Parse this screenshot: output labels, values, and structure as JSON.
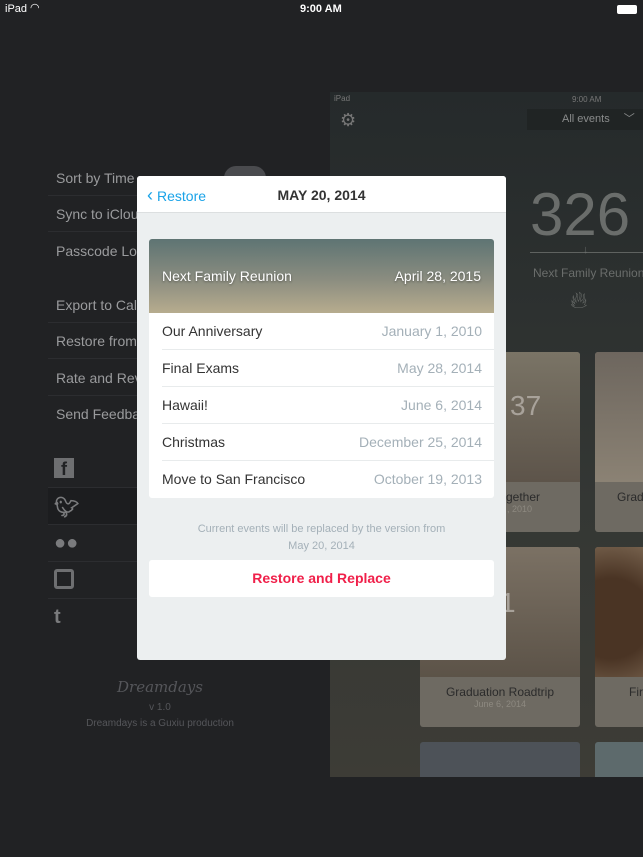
{
  "status_bar": {
    "device": "iPad",
    "time": "9:00 AM"
  },
  "settings_menu": {
    "items": [
      "Sort by Time",
      "Sync to iCloud",
      "Passcode Lock",
      "Export to Calendar",
      "Restore from",
      "Rate and Review",
      "Send Feedback"
    ],
    "social": [
      "facebook-icon",
      "twitter-icon",
      "wechat-icon",
      "instagram-icon",
      "tumblr-icon"
    ],
    "logo": "Dreamdays",
    "version": "v 1.0",
    "credit": "Dreamdays is a Guxiu production"
  },
  "background_app": {
    "status_device": "iPad",
    "status_time": "9:00 AM",
    "filter": "All events",
    "countdown": "326",
    "countdown_label": "Next Family Reunion",
    "tiles": [
      {
        "number": "37",
        "title": "gether",
        "date": ", 2010"
      },
      {
        "title": "Grad"
      },
      {
        "number": "1",
        "title": "Graduation Roadtrip",
        "date": "June 6, 2014"
      },
      {
        "title": "Fir"
      }
    ]
  },
  "modal": {
    "back_label": "Restore",
    "title": "MAY 20, 2014",
    "hero": {
      "name": "Next Family Reunion",
      "date": "April 28, 2015"
    },
    "events": [
      {
        "name": "Our Anniversary",
        "date": "January 1, 2010"
      },
      {
        "name": "Final Exams",
        "date": "May 28, 2014"
      },
      {
        "name": "Hawaii!",
        "date": "June 6, 2014"
      },
      {
        "name": "Christmas",
        "date": "December 25, 2014"
      },
      {
        "name": "Move to San Francisco",
        "date": "October 19, 2013"
      }
    ],
    "note_line1": "Current events will be replaced by the version from",
    "note_line2": "May 20, 2014",
    "action_label": "Restore and Replace"
  },
  "colors": {
    "accent": "#1aa3e8",
    "destructive": "#f0204a"
  }
}
